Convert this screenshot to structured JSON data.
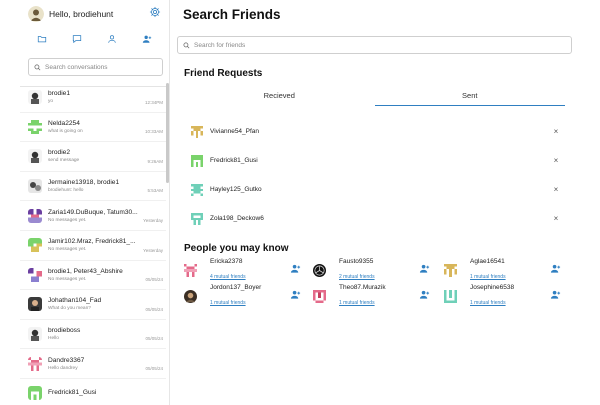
{
  "sidebar": {
    "greeting": "Hello, brodiehunt",
    "search_placeholder": "Search conversations",
    "icons": [
      "folder-icon",
      "chat-icon",
      "user-icon",
      "add-user-icon"
    ],
    "conversations": [
      {
        "name": "brodie1",
        "message": "yo",
        "time": "12:34PM"
      },
      {
        "name": "Nelda2254",
        "message": "what is going on",
        "time": "10:33AM"
      },
      {
        "name": "brodie2",
        "message": "send message",
        "time": "9:26AM"
      },
      {
        "name": "Jermaine13918, brodie1",
        "message": "brodiehunt: hello",
        "time": "5:53AM"
      },
      {
        "name": "Zaria149.DuBuque, Tatum30...",
        "message": "No messages yet.",
        "time": "Yesterday"
      },
      {
        "name": "Jamir102.Mraz, Fredrick81_...",
        "message": "No messages yet.",
        "time": "Yesterday"
      },
      {
        "name": "brodie1, Peter43_Abshire",
        "message": "No messages yet.",
        "time": "05/05/24"
      },
      {
        "name": "Johathan104_Fad",
        "message": "What do you mean?",
        "time": "05/05/24"
      },
      {
        "name": "brodieboss",
        "message": "Hello",
        "time": "05/05/24"
      },
      {
        "name": "Dandre3367",
        "message": "Hello dandrey",
        "time": "05/05/24"
      },
      {
        "name": "Fredrick81_Gusi",
        "message": "",
        "time": ""
      }
    ]
  },
  "main": {
    "title": "Search Friends",
    "search_placeholder": "Search for friends",
    "requests_title": "Friend Requests",
    "tabs": [
      {
        "label": "Recieved"
      },
      {
        "label": "Sent"
      }
    ],
    "active_tab": 1,
    "requests": [
      {
        "name": "Vivianne54_Pfan"
      },
      {
        "name": "Fredrick81_Gusi"
      },
      {
        "name": "Hayley125_Gutko"
      },
      {
        "name": "Zola198_Deckow6"
      }
    ],
    "close_glyph": "×",
    "people_title": "People you may know",
    "people": [
      {
        "name": "Ericka2378",
        "mutual": "4 mutual friends"
      },
      {
        "name": "Fausto9355",
        "mutual": "2 mutual friends"
      },
      {
        "name": "Aglae16541",
        "mutual": "1 mutual friends"
      },
      {
        "name": "Jordon137_Boyer",
        "mutual": "1 mutual friends"
      },
      {
        "name": "Theo87.Murazik",
        "mutual": "1 mutual friends"
      },
      {
        "name": "Josephine6538",
        "mutual": "1 mutual friends"
      }
    ]
  },
  "colors": {
    "accent": "#2f7fc1",
    "identicon_green": "#7ad36b",
    "identicon_teal": "#6fd0b8",
    "identicon_gold": "#d8b65a",
    "identicon_pink": "#e46a8a",
    "identicon_purple": "#6b3fa0"
  }
}
